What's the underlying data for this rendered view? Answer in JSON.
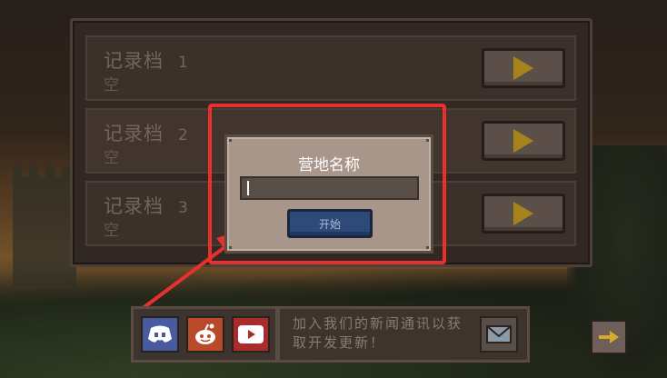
{
  "save_slots": [
    {
      "label": "记录档",
      "number": "1",
      "status": "空"
    },
    {
      "label": "记录档",
      "number": "2",
      "status": "空"
    },
    {
      "label": "记录档",
      "number": "3",
      "status": "空"
    }
  ],
  "dialog": {
    "title": "营地名称",
    "input_value": "",
    "start_label": "开始"
  },
  "social": {
    "icons": [
      "discord-icon",
      "reddit-icon",
      "youtube-icon"
    ]
  },
  "newsletter": {
    "text": "加入我们的新闻通讯以获取开发更新！"
  },
  "colors": {
    "highlight": "#e8302e",
    "play_triangle": "#c8a020",
    "start_button": "#2e4a78"
  }
}
